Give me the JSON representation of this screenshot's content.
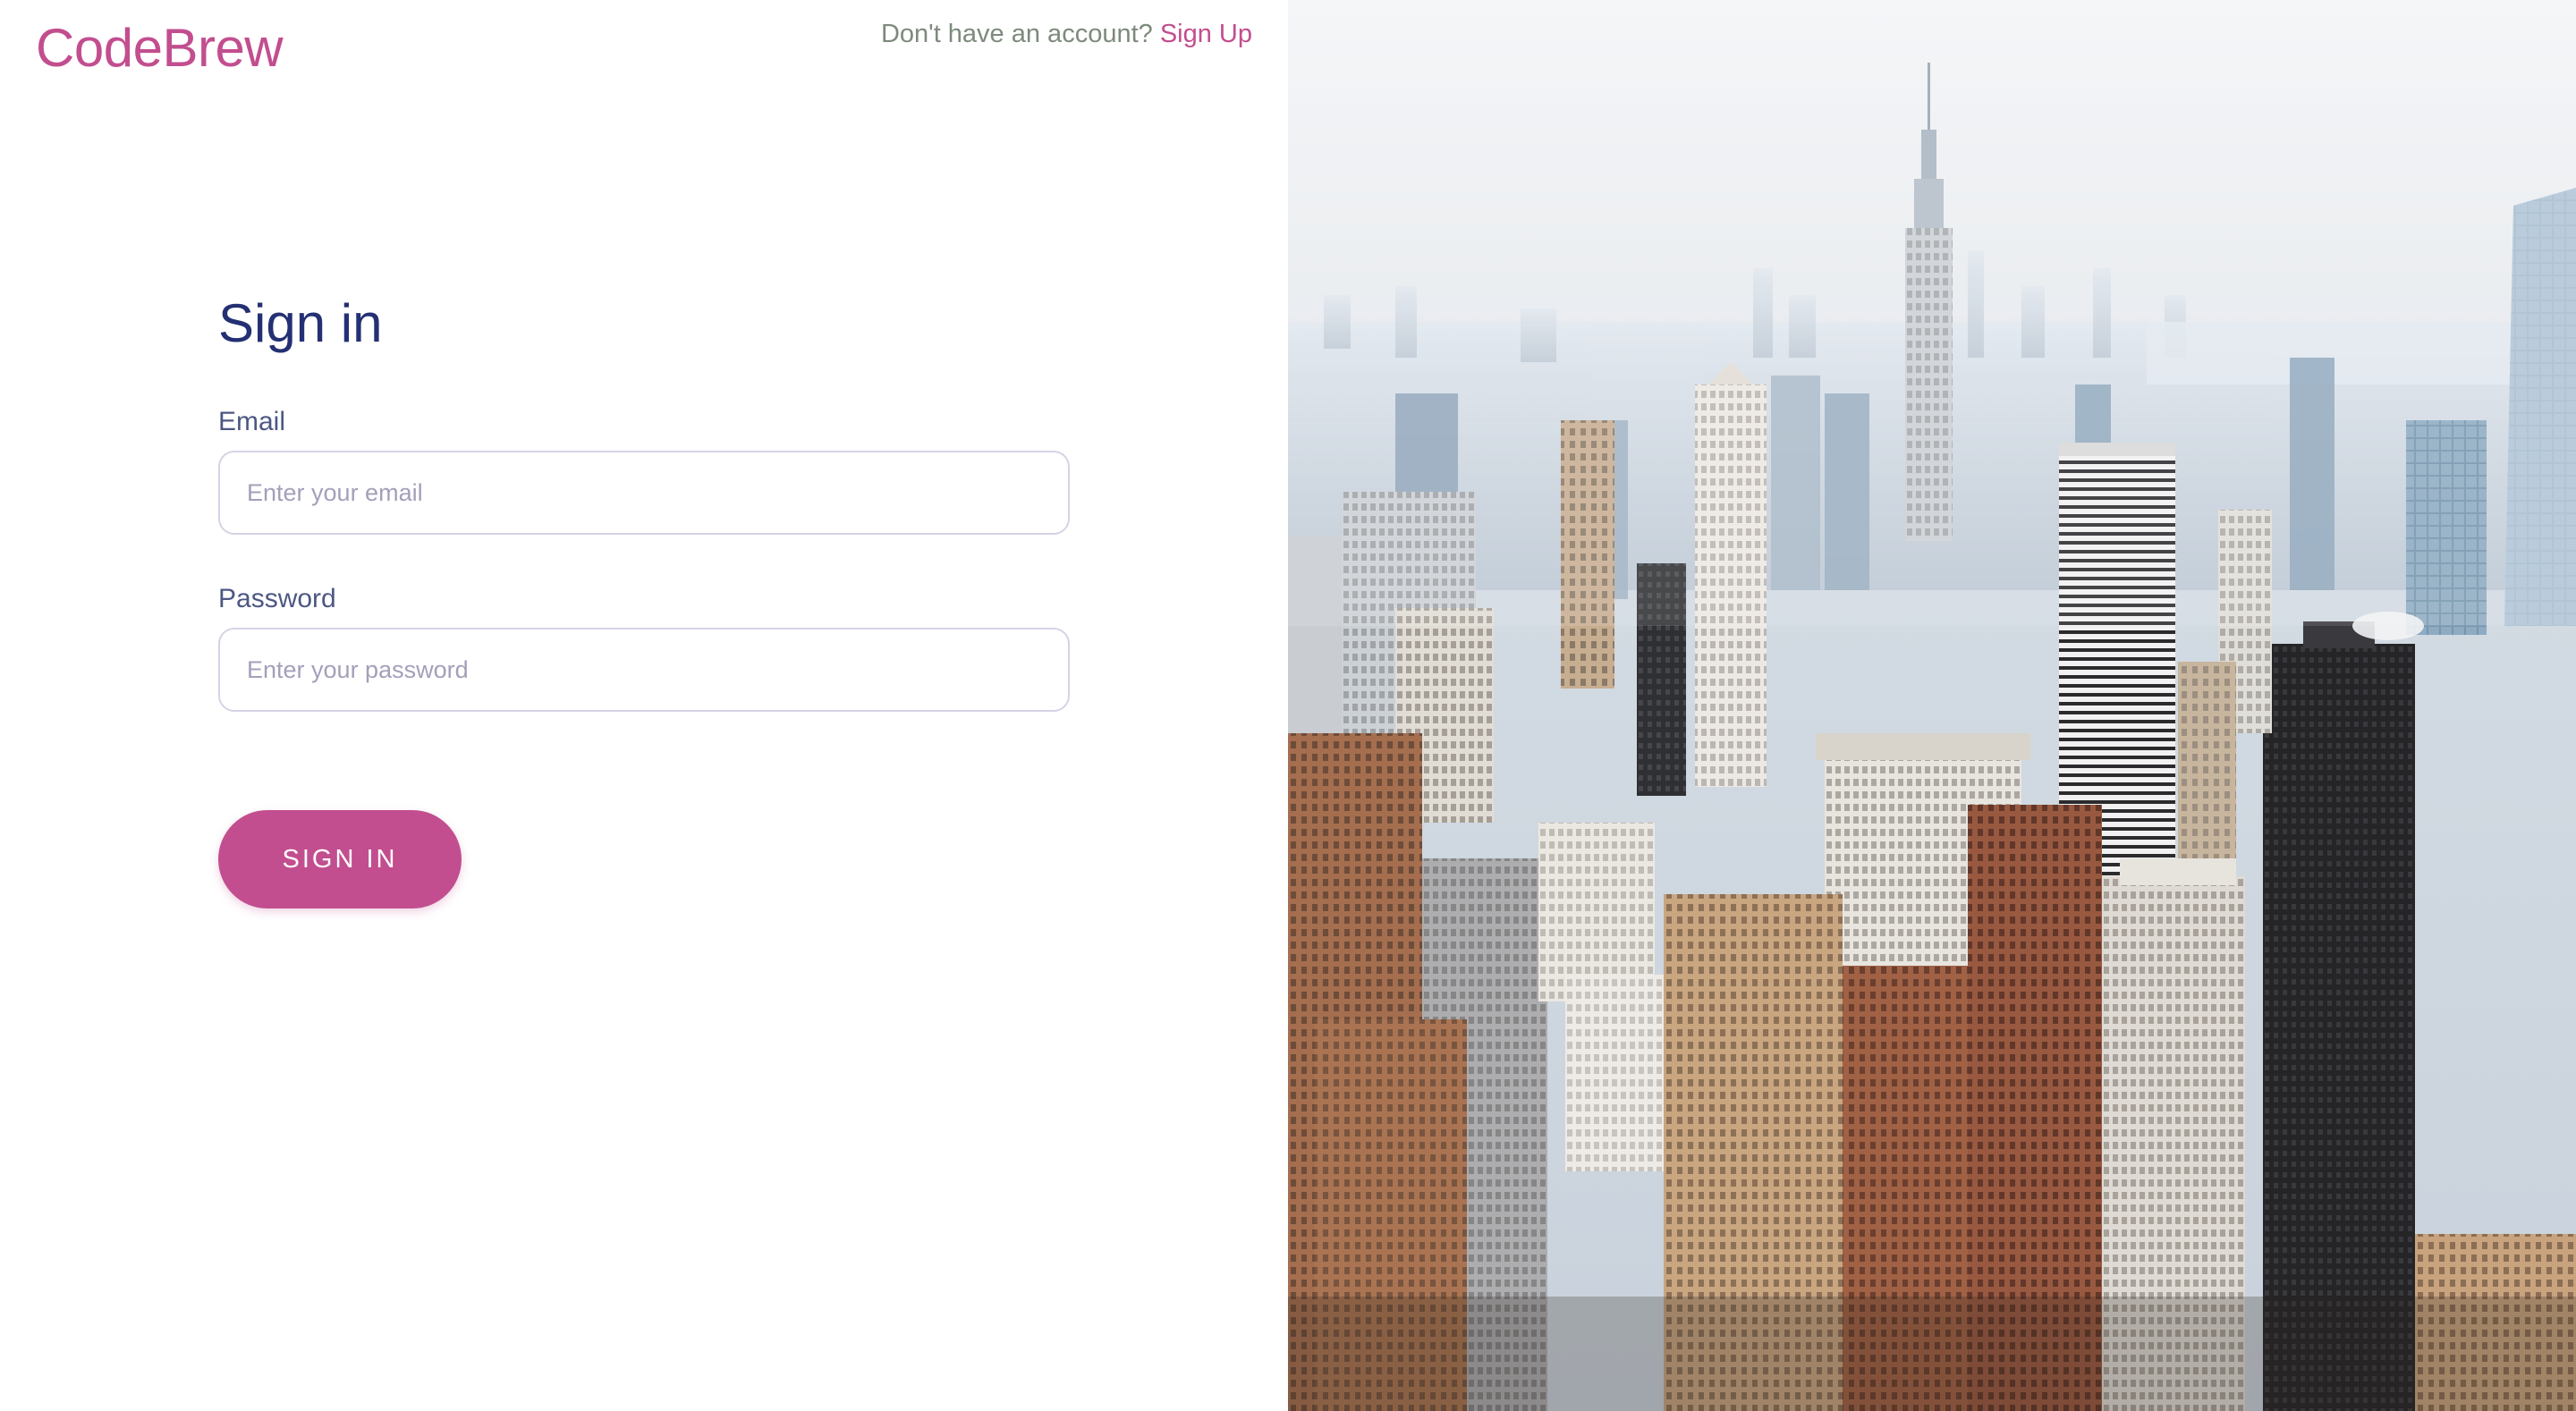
{
  "brand": {
    "name": "CodeBrew",
    "accent_color": "#c24e8f"
  },
  "header": {
    "prompt": "Don't have an account?",
    "signup_link": "Sign Up"
  },
  "form": {
    "title": "Sign in",
    "email": {
      "label": "Email",
      "placeholder": "Enter your email",
      "value": ""
    },
    "password": {
      "label": "Password",
      "placeholder": "Enter your password",
      "value": ""
    },
    "submit_label": "SIGN IN"
  },
  "hero_image": {
    "subject": "aerial city skyline photo"
  }
}
